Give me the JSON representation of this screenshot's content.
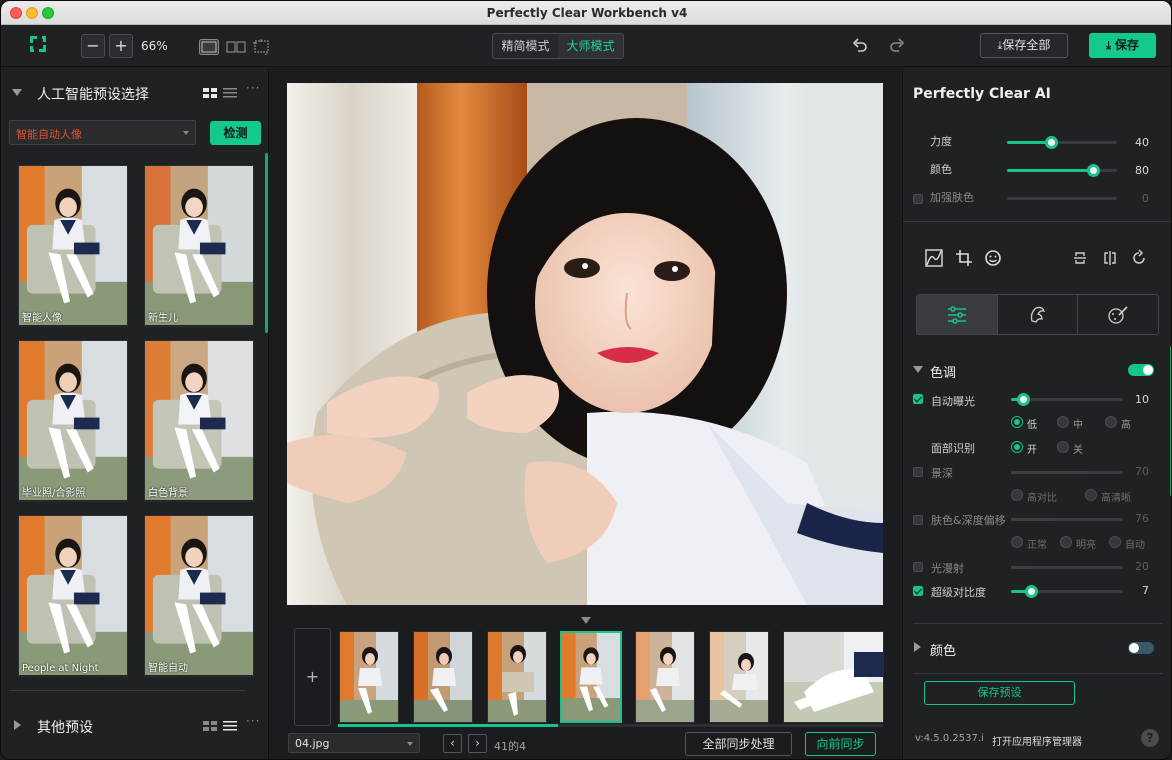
{
  "window": {
    "title": "Perfectly Clear Workbench v4"
  },
  "toolbar": {
    "zoom_out": "−",
    "zoom_in": "+",
    "zoom_level": "66%",
    "modes": [
      {
        "label": "精简模式",
        "active": false
      },
      {
        "label": "大师模式",
        "active": true
      }
    ],
    "save_all_label": "保存全部",
    "save_label": "保存",
    "accent": "#14c98f"
  },
  "left_panel": {
    "ai_section_title": "人工智能预设选择",
    "preset_selected": "智能自动人像",
    "detect_label": "检测",
    "presets": [
      {
        "label": "智能人像"
      },
      {
        "label": "新生儿"
      },
      {
        "label": "毕业照/合影照"
      },
      {
        "label": "白色背景"
      },
      {
        "label": "People at Night"
      },
      {
        "label": "智能自动"
      }
    ],
    "other_section_title": "其他预设"
  },
  "center": {
    "add_label": "+",
    "file_name": "04.jpg",
    "prev_label": "‹",
    "next_label": "›",
    "count_text": "41的4",
    "sync_all_label": "全部同步处理",
    "sync_forward_label": "向前同步",
    "filmstrip_active_index": 3
  },
  "right_panel": {
    "title": "Perfectly Clear AI",
    "strength": {
      "label": "力度",
      "value": "40",
      "fraction": 0.4
    },
    "color": {
      "label": "颜色",
      "value": "80",
      "fraction": 0.8
    },
    "skin": {
      "label": "加强肤色",
      "value": "0",
      "fraction": 0.0,
      "checked": false
    },
    "tone_section": {
      "title": "色调",
      "enabled": true,
      "auto_exposure": {
        "label": "自动曝光",
        "value": "10",
        "fraction": 0.1,
        "checked": true
      },
      "exposure_levels": [
        {
          "label": "低",
          "on": true
        },
        {
          "label": "中",
          "on": false
        },
        {
          "label": "高",
          "on": false
        }
      ],
      "face_detect": {
        "label": "面部识别",
        "options": [
          {
            "label": "开",
            "on": true
          },
          {
            "label": "关",
            "on": false
          }
        ]
      },
      "depth": {
        "label": "景深",
        "value": "70",
        "fraction": 0.7,
        "checked": false
      },
      "depth_options": [
        {
          "label": "高对比"
        },
        {
          "label": "高清晰"
        }
      ],
      "skin_depth": {
        "label": "肤色&深度偏移",
        "value": "76",
        "fraction": 0.4,
        "checked": false
      },
      "skin_options": [
        {
          "label": "正常"
        },
        {
          "label": "明亮"
        },
        {
          "label": "自动"
        }
      ],
      "diffuse": {
        "label": "光漫射",
        "value": "20",
        "fraction": 0.2,
        "checked": false
      },
      "super_contrast": {
        "label": "超级对比度",
        "value": "7",
        "fraction": 0.18,
        "checked": true
      }
    },
    "color_section": {
      "title": "颜色",
      "enabled": false
    },
    "save_preset_label": "保存预设",
    "version": "v:4.5.0.2537.i",
    "app_manager_label": "打开应用程序管理器",
    "help_label": "?"
  }
}
